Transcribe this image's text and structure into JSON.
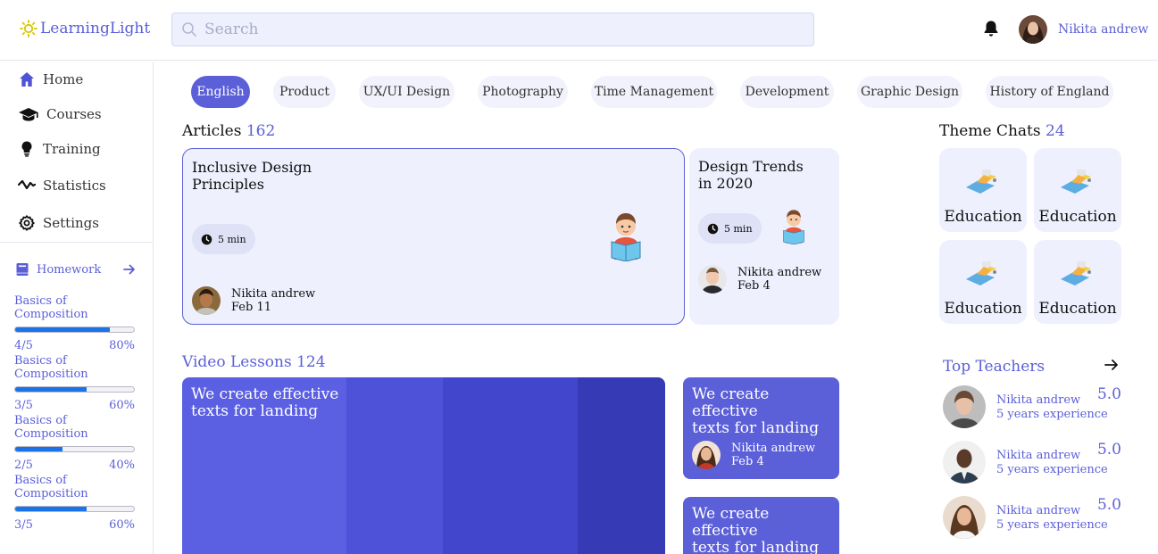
{
  "app": {
    "name": "LearningLight"
  },
  "search": {
    "placeholder": "Search"
  },
  "user": {
    "name": "Nikita andrew"
  },
  "nav": {
    "items": [
      {
        "label": "Home",
        "icon": "home-icon"
      },
      {
        "label": "Courses",
        "icon": "graduation-cap-icon"
      },
      {
        "label": "Training",
        "icon": "lightbulb-icon"
      },
      {
        "label": "Statistics",
        "icon": "activity-icon"
      },
      {
        "label": "Settings",
        "icon": "gear-icon"
      }
    ]
  },
  "homework": {
    "label": "Homework",
    "items": [
      {
        "title": "Basics of Composition",
        "done": "4/5",
        "percent": "80%",
        "progress": 0.8
      },
      {
        "title": "Basics of Composition",
        "done": "3/5",
        "percent": "60%",
        "progress": 0.6
      },
      {
        "title": "Basics of Composition",
        "done": "2/5",
        "percent": "40%",
        "progress": 0.4
      },
      {
        "title": "Basics of Composition",
        "done": "3/5",
        "percent": "60%",
        "progress": 0.6
      }
    ]
  },
  "tags": [
    {
      "label": "English",
      "active": true
    },
    {
      "label": "Product",
      "active": false
    },
    {
      "label": "UX/UI Design",
      "active": false
    },
    {
      "label": "Photography",
      "active": false
    },
    {
      "label": "Time Management",
      "active": false
    },
    {
      "label": "Development",
      "active": false
    },
    {
      "label": "Graphic Design",
      "active": false
    },
    {
      "label": "History of England",
      "active": false
    }
  ],
  "articles": {
    "title": "Articles",
    "count": "162",
    "cards": [
      {
        "title_line1": "Inclusive Design",
        "title_line2": "Principles",
        "time": "5 min",
        "author": "Nikita andrew",
        "date": "Feb 11"
      },
      {
        "title_line1": "Design Trends",
        "title_line2": "in 2020",
        "time": "5 min",
        "author": "Nikita andrew",
        "date": "Feb 4"
      }
    ]
  },
  "videos": {
    "title": "Video Lessons 124",
    "main": {
      "title_line1": "We create effective",
      "title_line2": "texts for landing"
    },
    "cards": [
      {
        "title_line1": "We create effective",
        "title_line2": "texts for landing",
        "author": "Nikita andrew",
        "date": "Feb 4"
      },
      {
        "title_line1": "We create effective",
        "title_line2": "texts for landing"
      }
    ]
  },
  "theme_chats": {
    "title": "Theme Chats",
    "count": "24",
    "items": [
      {
        "label": "Education"
      },
      {
        "label": "Education"
      },
      {
        "label": "Education"
      },
      {
        "label": "Education"
      }
    ]
  },
  "top_teachers": {
    "title": "Top Teachers",
    "items": [
      {
        "name": "Nikita andrew",
        "experience": "5 years experience",
        "rating": "5.0"
      },
      {
        "name": "Nikita andrew",
        "experience": "5 years experience",
        "rating": "5.0"
      },
      {
        "name": "Nikita andrew",
        "experience": "5 years experience",
        "rating": "5.0"
      }
    ]
  },
  "colors": {
    "accent": "#5b5fd8",
    "card_bg": "#eef0fd",
    "progress": "#1a73e8"
  }
}
